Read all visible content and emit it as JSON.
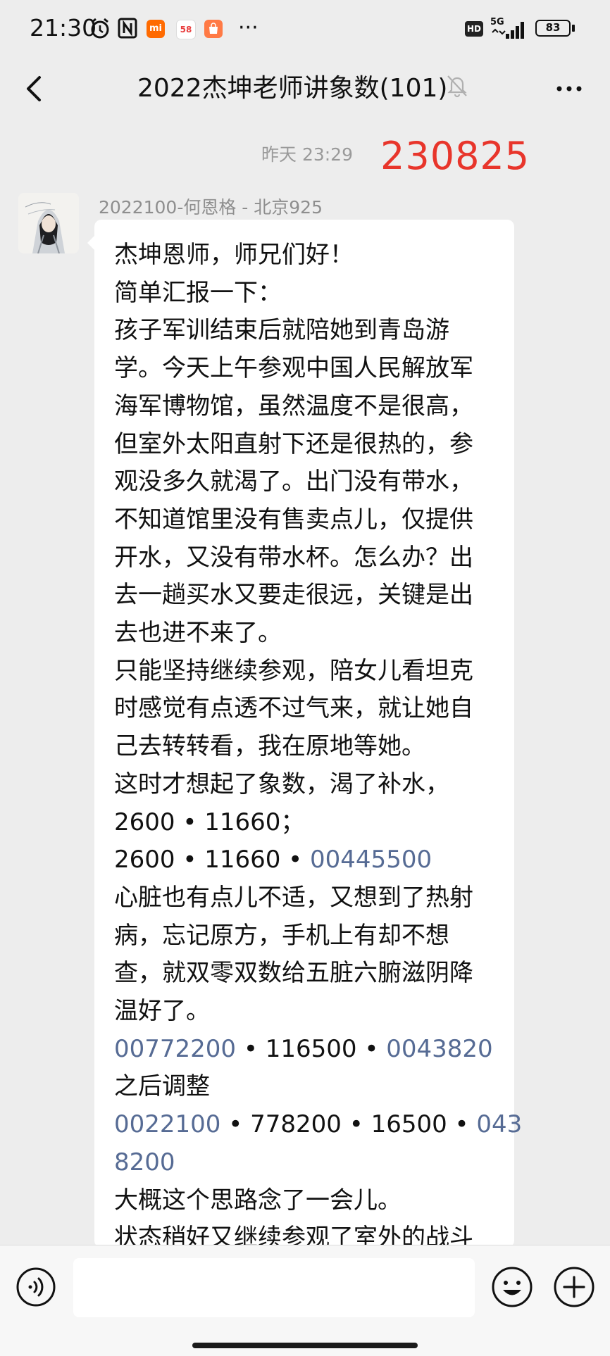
{
  "status_bar": {
    "time": "21:30",
    "app_icons": [
      {
        "name": "mi-icon",
        "label": "mi",
        "color": "#ff6a00"
      },
      {
        "name": "58-icon",
        "label": "58",
        "color": "#ffffff"
      },
      {
        "name": "taobao-icon",
        "label": "",
        "color": "#ff7a45"
      }
    ],
    "more": "···",
    "hd": "HD",
    "network": "5G",
    "battery": "83"
  },
  "header": {
    "title": "2022杰坤老师讲象数(101)",
    "back_icon": "chevron-left-icon",
    "mute_icon": "bell-off-icon",
    "menu_icon": "more-horizontal-icon"
  },
  "chat": {
    "timestamp": "昨天 23:29",
    "overlay_number": "230825",
    "sender": "2022100-何恩格 - 北京925",
    "message_lines": [
      [
        {
          "t": "杰坤恩师，师兄们好！"
        }
      ],
      [
        {
          "t": "简单汇报一下："
        }
      ],
      [
        {
          "t": "孩子军训结束后就陪她到青岛游"
        }
      ],
      [
        {
          "t": "学。今天上午参观中国人民解放军"
        }
      ],
      [
        {
          "t": "海军博物馆，虽然温度不是很高，"
        }
      ],
      [
        {
          "t": "但室外太阳直射下还是很热的，参"
        }
      ],
      [
        {
          "t": "观没多久就渴了。出门没有带水，"
        }
      ],
      [
        {
          "t": "不知道馆里没有售卖点儿，仅提供"
        }
      ],
      [
        {
          "t": "开水，又没有带水杯。怎么办？出"
        }
      ],
      [
        {
          "t": "去一趟买水又要走很远，关键是出"
        }
      ],
      [
        {
          "t": "去也进不来了。"
        }
      ],
      [
        {
          "t": "只能坚持继续参观，陪女儿看坦克"
        }
      ],
      [
        {
          "t": "时感觉有点透不过气来，就让她自"
        }
      ],
      [
        {
          "t": "己去转转看，我在原地等她。"
        }
      ],
      [
        {
          "t": "这时才想起了象数，渴了补水，"
        }
      ],
      [
        {
          "t": "2600 • 11660；"
        }
      ],
      [
        {
          "t": "2600 • 11660 • "
        },
        {
          "t": "00445500",
          "link": true
        }
      ],
      [
        {
          "t": "心脏也有点儿不适，又想到了热射"
        }
      ],
      [
        {
          "t": "病，忘记原方，手机上有却不想"
        }
      ],
      [
        {
          "t": "查，就双零双数给五脏六腑滋阴降"
        }
      ],
      [
        {
          "t": "温好了。"
        }
      ],
      [
        {
          "t": "00772200",
          "link": true
        },
        {
          "t": " • 116500 • "
        },
        {
          "t": "0043820",
          "link": true
        }
      ],
      [
        {
          "t": "之后调整"
        }
      ],
      [
        {
          "t": "0022100",
          "link": true
        },
        {
          "t": " • 778200 • 16500 • "
        },
        {
          "t": "043",
          "link": true
        }
      ],
      [
        {
          "t": "8200",
          "link": true
        }
      ],
      [
        {
          "t": "大概这个思路念了一会儿。"
        }
      ],
      [
        {
          "t": "状态稍好又继续参观了室外的战斗"
        }
      ]
    ]
  },
  "input_bar": {
    "voice_icon": "voice-input-icon",
    "input_value": "",
    "emoji_icon": "emoji-icon",
    "plus_icon": "plus-circle-icon"
  }
}
